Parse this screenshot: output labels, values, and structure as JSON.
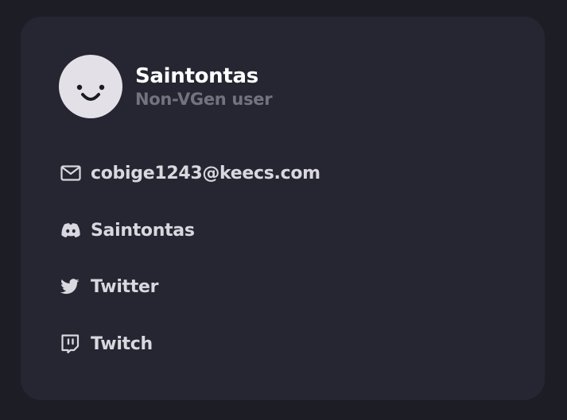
{
  "profile": {
    "name": "Saintontas",
    "role": "Non-VGen user",
    "avatar_icon": "smiley-face-icon",
    "avatar_bg": "#e3e1e7"
  },
  "contacts": [
    {
      "type": "email",
      "icon": "mail-icon",
      "label": "cobige1243@keecs.com"
    },
    {
      "type": "discord",
      "icon": "discord-icon",
      "label": "Saintontas"
    },
    {
      "type": "twitter",
      "icon": "twitter-icon",
      "label": "Twitter"
    },
    {
      "type": "twitch",
      "icon": "twitch-icon",
      "label": "Twitch"
    }
  ],
  "colors": {
    "page_bg": "#1d1d26",
    "card_bg": "#262632",
    "text_primary": "#ffffff",
    "text_secondary": "#73737f",
    "text_link": "#d9d8df"
  }
}
